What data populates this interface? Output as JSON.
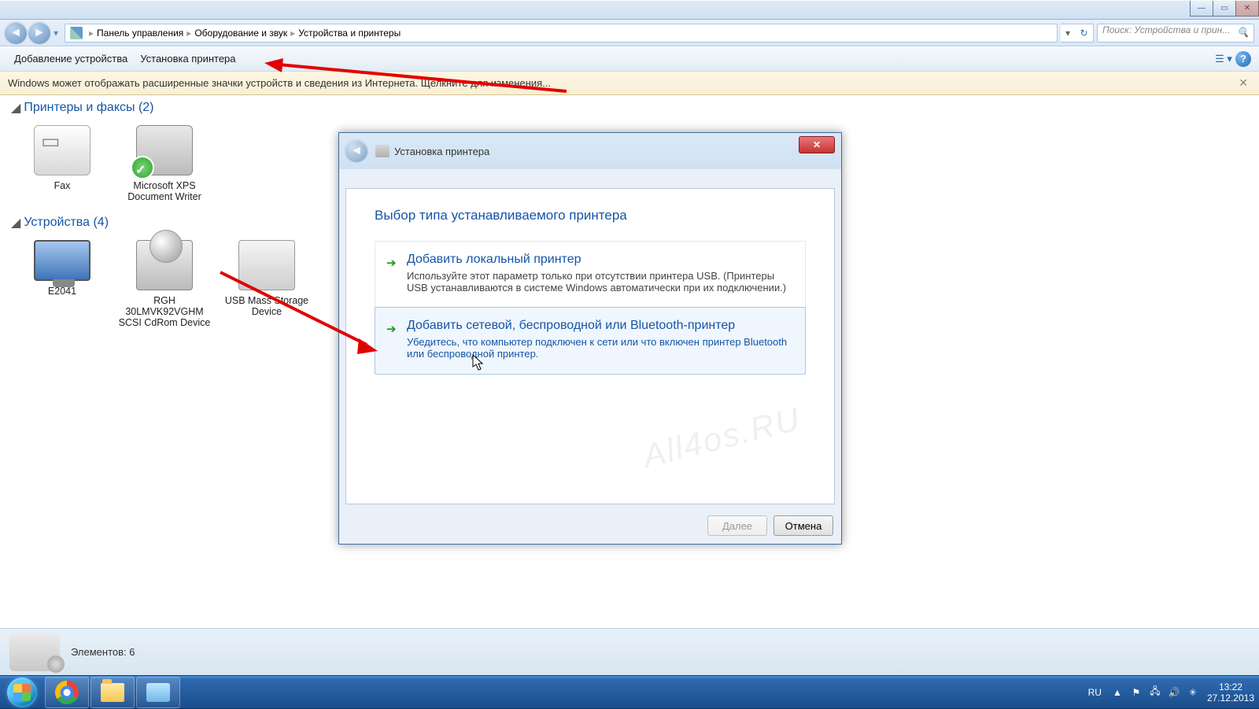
{
  "breadcrumb": {
    "item1": "Панель управления",
    "item2": "Оборудование и звук",
    "item3": "Устройства и принтеры"
  },
  "search": {
    "placeholder": "Поиск: Устройства и прин..."
  },
  "toolbar": {
    "add_device": "Добавление устройства",
    "add_printer": "Установка принтера"
  },
  "infobar": {
    "text": "Windows может отображать расширенные значки устройств и сведения из Интернета. Щелкните для изменения..."
  },
  "cats": {
    "printers": "Принтеры и факсы (2)",
    "devices": "Устройства (4)"
  },
  "items": {
    "fax": "Fax",
    "xps": "Microsoft XPS Document Writer",
    "mon": "E2041",
    "scsi": "RGH 30LMVK92VGHM SCSI CdRom Device",
    "usb": "USB Mass Storage Device"
  },
  "status": {
    "text": "Элементов: 6"
  },
  "dialog": {
    "title": "Установка принтера",
    "heading": "Выбор типа устанавливаемого принтера",
    "opt1_h": "Добавить локальный принтер",
    "opt1_p": "Используйте этот параметр только при отсутствии принтера USB. (Принтеры USB устанавливаются в системе Windows автоматически при их подключении.)",
    "opt2_h": "Добавить сетевой, беспроводной или Bluetooth-принтер",
    "opt2_p": "Убедитесь, что компьютер подключен к сети или что включен принтер Bluetooth или беспроводной принтер.",
    "next": "Далее",
    "cancel": "Отмена"
  },
  "watermark": "All4os.RU",
  "tray": {
    "lang": "RU",
    "time": "13:22",
    "date": "27.12.2013"
  }
}
